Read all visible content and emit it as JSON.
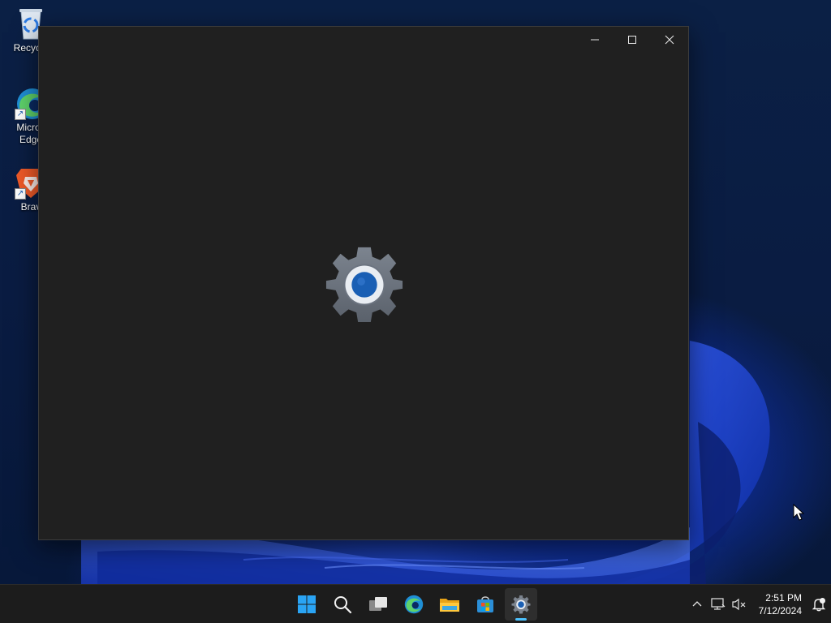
{
  "desktop": {
    "icons": [
      {
        "label": "Recycle",
        "icon": "recycle-bin-icon"
      },
      {
        "label": "Micros\nEdge",
        "icon": "edge-icon"
      },
      {
        "label": "Brav",
        "icon": "brave-icon"
      }
    ]
  },
  "window": {
    "caption": {
      "minimize_icon": "minimize-icon",
      "maximize_icon": "maximize-icon",
      "close_icon": "close-icon"
    },
    "splash_icon": "settings-gear-icon"
  },
  "taskbar": {
    "apps": [
      {
        "name": "start",
        "icon": "windows-logo-icon"
      },
      {
        "name": "search",
        "icon": "search-icon"
      },
      {
        "name": "task-view",
        "icon": "task-view-icon"
      },
      {
        "name": "edge",
        "icon": "edge-icon"
      },
      {
        "name": "file-explorer",
        "icon": "folder-icon"
      },
      {
        "name": "store",
        "icon": "store-icon"
      },
      {
        "name": "settings",
        "icon": "settings-gear-icon",
        "active": true
      }
    ],
    "tray": {
      "overflow_icon": "chevron-up-icon",
      "network_icon": "network-icon",
      "volume_icon": "volume-muted-icon",
      "time": "2:51 PM",
      "date": "7/12/2024",
      "notification_icon": "notification-bell-icon"
    }
  },
  "colors": {
    "window_bg": "#202020",
    "taskbar_bg": "#1c1c1c",
    "accent": "#4cc2ff",
    "gear_gray": "#6c7480",
    "gear_blue": "#1a5fb4"
  }
}
